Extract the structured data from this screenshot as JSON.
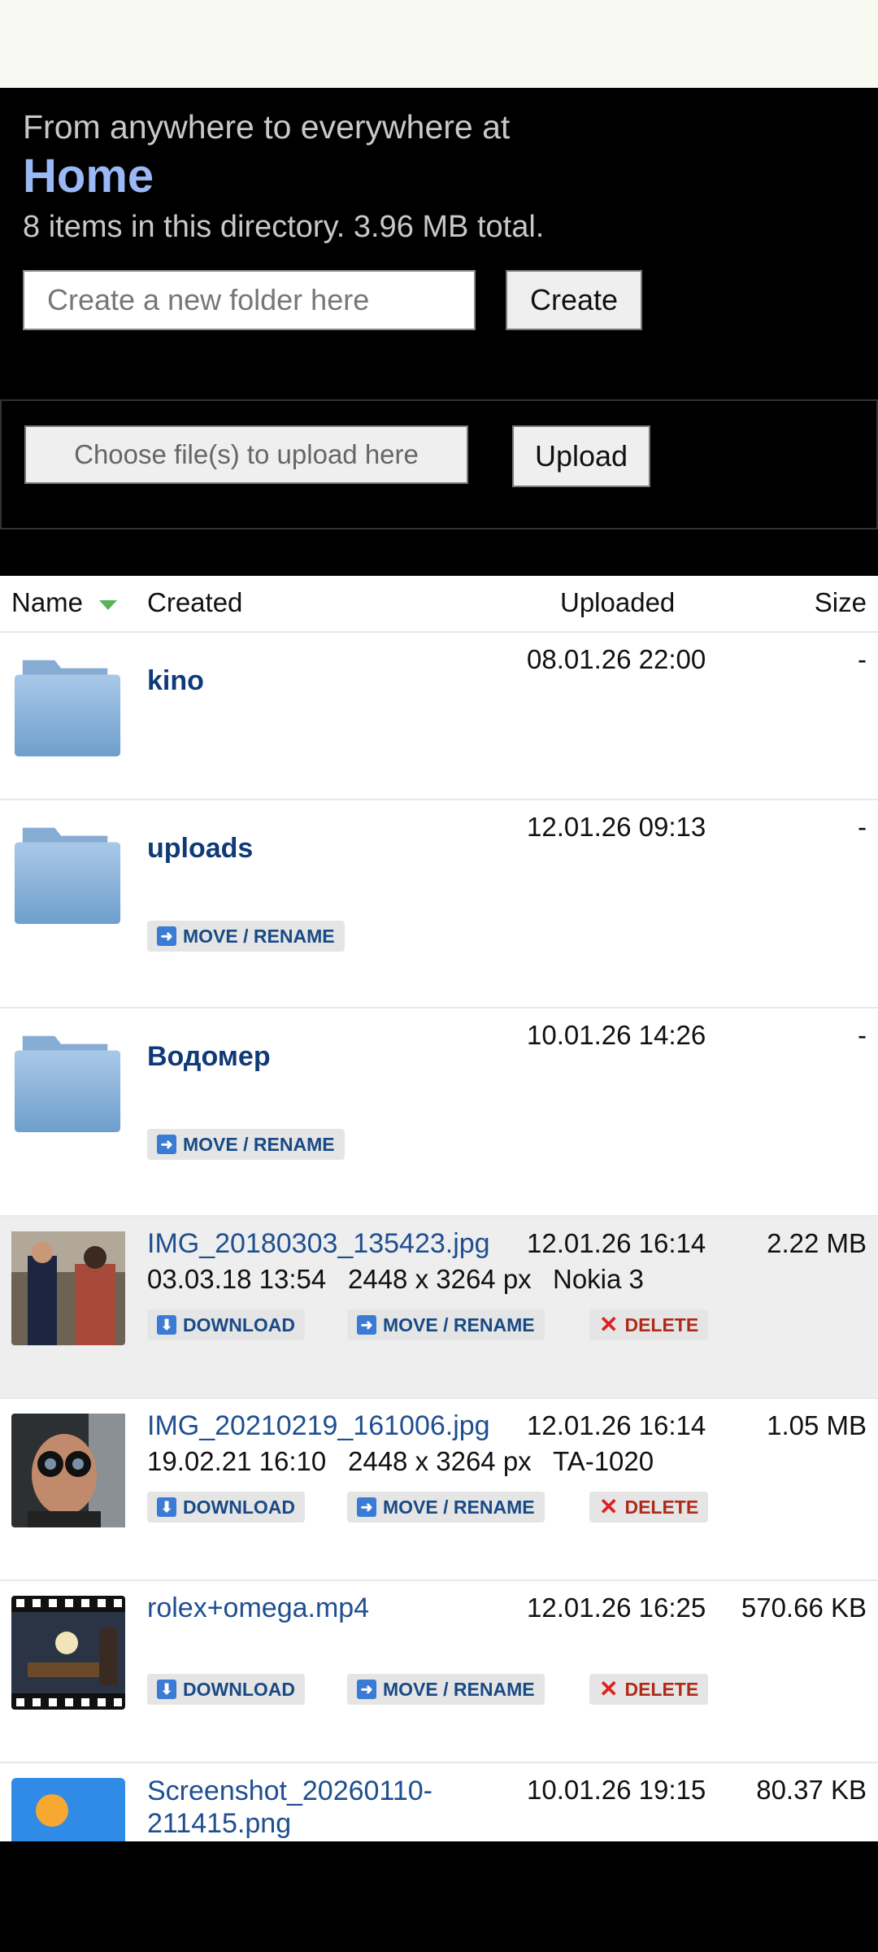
{
  "header": {
    "subtitle": "From anywhere to everywhere at",
    "title": "Home",
    "summary": "8 items in this directory. 3.96 MB total.",
    "folder_placeholder": "Create a new folder here",
    "create_label": "Create",
    "file_chooser_label": "Choose file(s) to upload here",
    "upload_label": "Upload"
  },
  "columns": {
    "name": "Name",
    "created": "Created",
    "uploaded": "Uploaded",
    "size": "Size"
  },
  "actions": {
    "download": "DOWNLOAD",
    "move": "MOVE / RENAME",
    "delete": "DELETE"
  },
  "items": [
    {
      "name": "kino",
      "uploaded": "08.01.26 22:00",
      "size": "-"
    },
    {
      "name": "uploads",
      "uploaded": "12.01.26 09:13",
      "size": "-"
    },
    {
      "name": "Водомер",
      "uploaded": "10.01.26 14:26",
      "size": "-"
    },
    {
      "name": "IMG_20180303_135423.jpg",
      "uploaded": "12.01.26 16:14",
      "size": "2.22 MB",
      "created": "03.03.18 13:54",
      "dimensions": "2448 x 3264 px",
      "camera": "Nokia 3"
    },
    {
      "name": "IMG_20210219_161006.jpg",
      "uploaded": "12.01.26 16:14",
      "size": "1.05 MB",
      "created": "19.02.21 16:10",
      "dimensions": "2448 x 3264 px",
      "camera": "TA-1020"
    },
    {
      "name": "rolex+omega.mp4",
      "uploaded": "12.01.26 16:25",
      "size": "570.66 KB"
    },
    {
      "name_line1": "Screenshot_20260110-",
      "name_line2": "211415.png",
      "uploaded": "10.01.26 19:15",
      "size": "80.37 KB"
    }
  ]
}
